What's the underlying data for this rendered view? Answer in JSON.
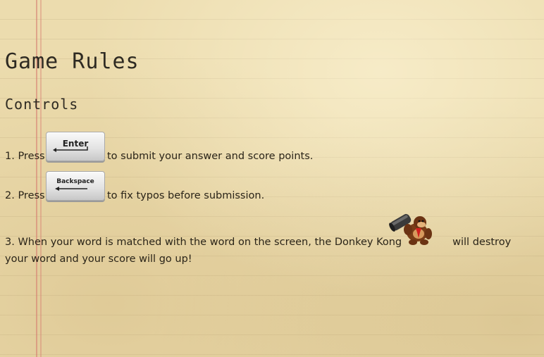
{
  "page": {
    "title": "Game Rules",
    "section": "Controls"
  },
  "rules": {
    "rule1": {
      "prefix": "1. Press",
      "key_label": "Enter",
      "suffix": "to submit your answer and score points."
    },
    "rule2": {
      "prefix": "2. Press",
      "key_label": "Backspace",
      "suffix": "to fix typos before submission."
    },
    "rule3": {
      "prefix": "3. When your word is matched with the word on the screen, the Donkey Kong",
      "suffix": "will destroy your word and your score will go up!",
      "character_icon": "donkey-kong-with-barrel-cannon"
    }
  },
  "colors": {
    "paper": "#ecdcae",
    "margin_line": "#d6786e",
    "text": "#2a2418"
  }
}
